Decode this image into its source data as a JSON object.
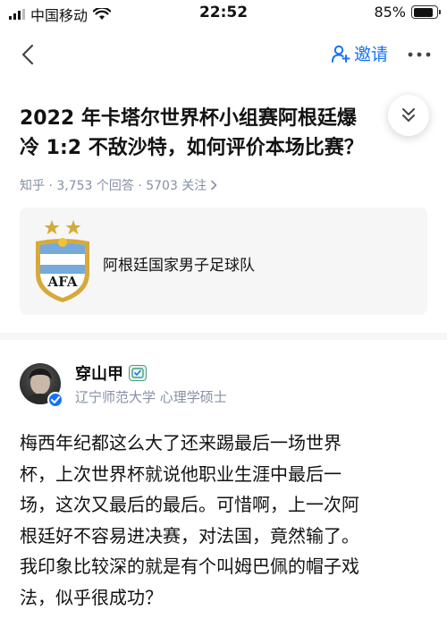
{
  "status_bar": {
    "carrier": "中国移动",
    "time": "22:52",
    "battery": "85%",
    "battery_level": 0.85
  },
  "nav": {
    "invite_label": "邀请"
  },
  "question": {
    "title_lines": [
      "2022 年卡塔尔世界杯小组赛阿根廷爆",
      "冷 1:2 不敌沙特，如何评价本场比赛？"
    ],
    "meta": "知乎 · 3,753 个回答 · 5703 关注"
  },
  "topic": {
    "name": "阿根廷国家男子足球队",
    "logo_text": "AFA"
  },
  "author": {
    "name": "穿山甲",
    "description": "辽宁师范大学 心理学硕士"
  },
  "answer": {
    "lines": [
      "梅西年纪都这么大了还来踢最后一场世界",
      "杯，上次世界杯就说他职业生涯中最后一",
      "场，这次又最后的最后。可惜啊，上一次阿",
      "根廷好不容易进决赛，对法国，竟然输了。",
      "我印象比较深的就是有个叫姆巴佩的帽子戏",
      "法，似乎很成功？"
    ]
  },
  "colors": {
    "accent": "#1772f6",
    "meta_gray": "#8590a6",
    "card_bg": "#f6f6f6"
  }
}
